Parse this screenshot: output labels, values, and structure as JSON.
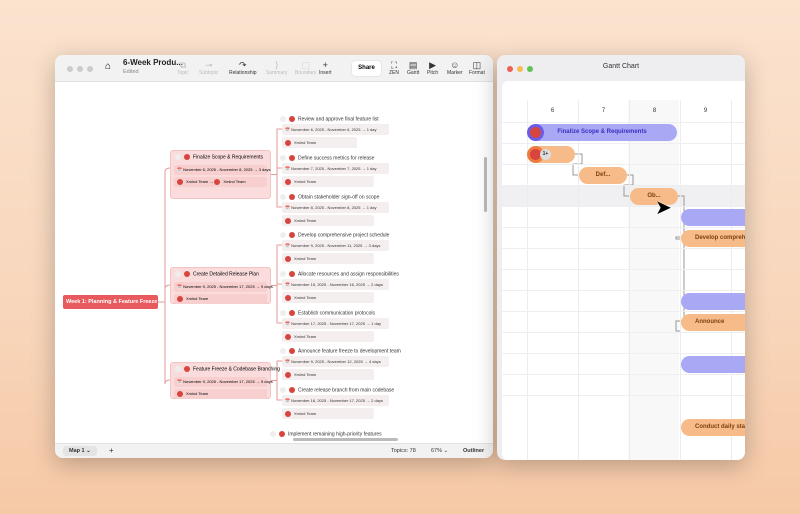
{
  "mindmap_window": {
    "title": "6-Week Produ...",
    "subtitle": "Edited",
    "toolbar": [
      {
        "label": "Topic",
        "icon": "topic-icon",
        "disabled": true
      },
      {
        "label": "Subtopic",
        "icon": "subtopic-icon",
        "disabled": true
      },
      {
        "label": "Relationship",
        "icon": "relationship-icon",
        "disabled": false
      },
      {
        "label": "Summary",
        "icon": "summary-icon",
        "disabled": true
      },
      {
        "label": "Boundary",
        "icon": "boundary-icon",
        "disabled": true
      },
      {
        "label": "Insert",
        "icon": "plus-icon",
        "disabled": false
      }
    ],
    "share": "Share",
    "right_toolbar": [
      {
        "label": "ZEN",
        "icon": "zen-icon"
      },
      {
        "label": "Gantt",
        "icon": "gantt-icon"
      },
      {
        "label": "Pitch",
        "icon": "pitch-icon"
      },
      {
        "label": "Marker",
        "icon": "marker-icon"
      },
      {
        "label": "Format",
        "icon": "format-icon"
      }
    ],
    "root": "Week 1: Planning & Feature Freeze",
    "main_topics": [
      {
        "title": "Finalize Scope & Requirements",
        "dates": "November 6, 2025 - November 8, 2025",
        "duration": "3 days",
        "team": "Xmind Team",
        "team2": "Xmind Team"
      },
      {
        "title": "Create Detailed Release Plan",
        "dates": "November 9, 2025 - November 17, 2025",
        "duration": "9 days",
        "team": "Xmind Team"
      },
      {
        "title": "Feature Freeze & Codebase Branching",
        "dates": "November 9, 2025 - November 17, 2025",
        "duration": "9 days",
        "team": "Xmind Team"
      }
    ],
    "subtopics": [
      {
        "title": "Review and approve final feature list",
        "dates": "November 6, 2025 - November 6, 2025",
        "duration": "1 day",
        "team": "Xmind Team"
      },
      {
        "title": "Define success metrics for release",
        "dates": "November 7, 2025 - November 7, 2025",
        "duration": "1 day",
        "team": "Xmind Team"
      },
      {
        "title": "Obtain stakeholder sign-off on scope",
        "dates": "November 8, 2025 - November 8, 2025",
        "duration": "1 day",
        "team": "Xmind Team"
      },
      {
        "title": "Develop comprehensive project schedule",
        "dates": "November 9, 2025 - November 11, 2025",
        "duration": "3 days",
        "team": "Xmind Team"
      },
      {
        "title": "Allocate resources and assign responsibilities",
        "dates": "November 15, 2025 - November 16, 2025",
        "duration": "2 days",
        "team": "Xmind Team"
      },
      {
        "title": "Establish communication protocols",
        "dates": "November 17, 2025 - November 17, 2025",
        "duration": "1 day",
        "team": "Xmind Team"
      },
      {
        "title": "Announce feature freeze to development team",
        "dates": "November 9, 2025 - November 12, 2025",
        "duration": "4 days",
        "team": "Xmind Team"
      },
      {
        "title": "Create release branch from main codebase",
        "dates": "November 16, 2025 - November 17, 2025",
        "duration": "2 days",
        "team": "Xmind Team"
      }
    ],
    "extra_topic": "Implement remaining high-priority features",
    "status": {
      "map_tab": "Map 1",
      "topics": "Topics: 78",
      "zoom": "67%",
      "outliner": "Outliner"
    }
  },
  "gantt_window": {
    "title": "Gantt Chart",
    "days": [
      "6",
      "7",
      "8",
      "9"
    ],
    "bars": [
      {
        "label": "Finalize Scope & Requirements",
        "kind": "parent"
      },
      {
        "label": "1+",
        "kind": "task"
      },
      {
        "label": "Def...",
        "kind": "task"
      },
      {
        "label": "Ob...",
        "kind": "task"
      },
      {
        "label": "",
        "kind": "parent"
      },
      {
        "label": "Develop compreh",
        "kind": "task"
      },
      {
        "label": "",
        "kind": "parent"
      },
      {
        "label": "Announce",
        "kind": "task"
      },
      {
        "label": "",
        "kind": "parent"
      },
      {
        "label": "Conduct daily sta",
        "kind": "task"
      }
    ],
    "colors": {
      "parent": "#a9a8f5",
      "task": "#f6bb88"
    }
  }
}
